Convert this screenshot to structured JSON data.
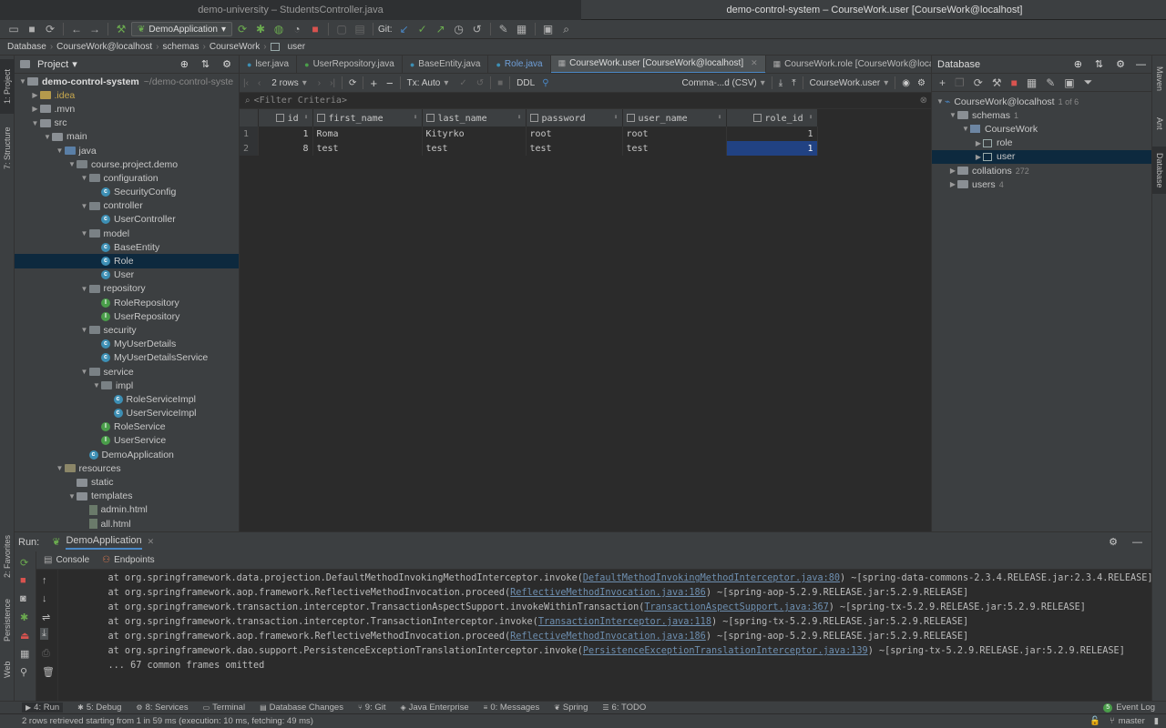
{
  "titlebar": {
    "left": "demo-university – StudentsController.java",
    "right": "demo-control-system – CourseWork.user [CourseWork@localhost]"
  },
  "toolbar": {
    "run_config": "DemoApplication",
    "git_label": "Git:"
  },
  "breadcrumb": [
    "Database",
    "CourseWork@localhost",
    "schemas",
    "CourseWork",
    "user"
  ],
  "left_strip": {
    "project": "1: Project",
    "structure": "7: Structure",
    "favorites": "2: Favorites",
    "persistence": "Persistence",
    "web": "Web"
  },
  "right_strip": {
    "maven": "Maven",
    "ant": "Ant",
    "database": "Database"
  },
  "project": {
    "title": "Project",
    "root_name": "demo-control-system",
    "root_path": "~/demo-control-syste",
    "items": [
      {
        "label": ".idea",
        "indent": 1,
        "type": "idea",
        "arrow": "▶"
      },
      {
        "label": ".mvn",
        "indent": 1,
        "type": "folder",
        "arrow": "▶"
      },
      {
        "label": "src",
        "indent": 1,
        "type": "folder",
        "arrow": "▼"
      },
      {
        "label": "main",
        "indent": 2,
        "type": "folder",
        "arrow": "▼"
      },
      {
        "label": "java",
        "indent": 3,
        "type": "src",
        "arrow": "▼"
      },
      {
        "label": "course.project.demo",
        "indent": 4,
        "type": "pkg",
        "arrow": "▼"
      },
      {
        "label": "configuration",
        "indent": 5,
        "type": "pkg",
        "arrow": "▼"
      },
      {
        "label": "SecurityConfig",
        "indent": 6,
        "type": "class",
        "arrow": ""
      },
      {
        "label": "controller",
        "indent": 5,
        "type": "pkg",
        "arrow": "▼"
      },
      {
        "label": "UserController",
        "indent": 6,
        "type": "class",
        "arrow": ""
      },
      {
        "label": "model",
        "indent": 5,
        "type": "pkg",
        "arrow": "▼"
      },
      {
        "label": "BaseEntity",
        "indent": 6,
        "type": "class",
        "arrow": ""
      },
      {
        "label": "Role",
        "indent": 6,
        "type": "class",
        "arrow": "",
        "selected": true
      },
      {
        "label": "User",
        "indent": 6,
        "type": "class",
        "arrow": ""
      },
      {
        "label": "repository",
        "indent": 5,
        "type": "pkg",
        "arrow": "▼"
      },
      {
        "label": "RoleRepository",
        "indent": 6,
        "type": "interface",
        "arrow": ""
      },
      {
        "label": "UserRepository",
        "indent": 6,
        "type": "interface",
        "arrow": ""
      },
      {
        "label": "security",
        "indent": 5,
        "type": "pkg",
        "arrow": "▼"
      },
      {
        "label": "MyUserDetails",
        "indent": 6,
        "type": "class",
        "arrow": ""
      },
      {
        "label": "MyUserDetailsService",
        "indent": 6,
        "type": "class",
        "arrow": ""
      },
      {
        "label": "service",
        "indent": 5,
        "type": "pkg",
        "arrow": "▼"
      },
      {
        "label": "impl",
        "indent": 6,
        "type": "pkg",
        "arrow": "▼"
      },
      {
        "label": "RoleServiceImpl",
        "indent": 7,
        "type": "class",
        "arrow": ""
      },
      {
        "label": "UserServiceImpl",
        "indent": 7,
        "type": "class",
        "arrow": ""
      },
      {
        "label": "RoleService",
        "indent": 6,
        "type": "interface",
        "arrow": ""
      },
      {
        "label": "UserService",
        "indent": 6,
        "type": "interface",
        "arrow": ""
      },
      {
        "label": "DemoApplication",
        "indent": 5,
        "type": "class",
        "arrow": ""
      },
      {
        "label": "resources",
        "indent": 3,
        "type": "res",
        "arrow": "▼"
      },
      {
        "label": "static",
        "indent": 4,
        "type": "folder",
        "arrow": ""
      },
      {
        "label": "templates",
        "indent": 4,
        "type": "folder",
        "arrow": "▼"
      },
      {
        "label": "admin.html",
        "indent": 5,
        "type": "file",
        "arrow": ""
      },
      {
        "label": "all.html",
        "indent": 5,
        "type": "file",
        "arrow": ""
      }
    ]
  },
  "editor_tabs": [
    {
      "label": "lser.java",
      "active": false
    },
    {
      "label": "UserRepository.java",
      "active": false
    },
    {
      "label": "BaseEntity.java",
      "active": false
    },
    {
      "label": "Role.java",
      "active": false
    },
    {
      "label": "CourseWork.user [CourseWork@localhost]",
      "active": true
    },
    {
      "label": "CourseWork.role [CourseWork@localhost]",
      "active": false
    }
  ],
  "grid_toolbar": {
    "rows": "2 rows",
    "tx": "Tx: Auto",
    "ddl": "DDL",
    "format": "Comma-...d (CSV)",
    "target": "CourseWork.user"
  },
  "filter_placeholder": "<Filter Criteria>",
  "table": {
    "columns": [
      "id",
      "first_name",
      "last_name",
      "password",
      "user_name",
      "role_id"
    ],
    "rows": [
      {
        "n": "1",
        "cells": [
          "1",
          "Roma",
          "Kityrko",
          "root",
          "root",
          "1"
        ]
      },
      {
        "n": "2",
        "cells": [
          "8",
          "test",
          "test",
          "test",
          "test",
          "1"
        ]
      }
    ]
  },
  "database": {
    "title": "Database",
    "connection": "CourseWork@localhost",
    "connection_count": "1 of 6",
    "schemas_label": "schemas",
    "schemas_count": "1",
    "schema": "CourseWork",
    "tables": [
      "role",
      "user"
    ],
    "collations": "collations",
    "collations_count": "272",
    "users": "users",
    "users_count": "4"
  },
  "run": {
    "label": "Run:",
    "config": "DemoApplication",
    "tabs": [
      "Console",
      "Endpoints"
    ],
    "lines": [
      {
        "pre": "    at org.springframework.data.projection.DefaultMethodInvokingMethodInterceptor.invoke(",
        "link": "DefaultMethodInvokingMethodInterceptor.java:80",
        "post": ") ~[spring-data-commons-2.3.4.RELEASE.jar:2.3.4.RELEASE]"
      },
      {
        "pre": "    at org.springframework.aop.framework.ReflectiveMethodInvocation.proceed(",
        "link": "ReflectiveMethodInvocation.java:186",
        "post": ") ~[spring-aop-5.2.9.RELEASE.jar:5.2.9.RELEASE]"
      },
      {
        "pre": "    at org.springframework.transaction.interceptor.TransactionAspectSupport.invokeWithinTransaction(",
        "link": "TransactionAspectSupport.java:367",
        "post": ") ~[spring-tx-5.2.9.RELEASE.jar:5.2.9.RELEASE]"
      },
      {
        "pre": "    at org.springframework.transaction.interceptor.TransactionInterceptor.invoke(",
        "link": "TransactionInterceptor.java:118",
        "post": ") ~[spring-tx-5.2.9.RELEASE.jar:5.2.9.RELEASE]"
      },
      {
        "pre": "    at org.springframework.aop.framework.ReflectiveMethodInvocation.proceed(",
        "link": "ReflectiveMethodInvocation.java:186",
        "post": ") ~[spring-aop-5.2.9.RELEASE.jar:5.2.9.RELEASE]"
      },
      {
        "pre": "    at org.springframework.dao.support.PersistenceExceptionTranslationInterceptor.invoke(",
        "link": "PersistenceExceptionTranslationInterceptor.java:139",
        "post": ") ~[spring-tx-5.2.9.RELEASE.jar:5.2.9.RELEASE]"
      },
      {
        "pre": "    ... 67 common frames omitted",
        "link": "",
        "post": ""
      }
    ]
  },
  "bottom_tabs": [
    "4: Run",
    "5: Debug",
    "8: Services",
    "Terminal",
    "Database Changes",
    "9: Git",
    "Java Enterprise",
    "0: Messages",
    "Spring",
    "6: TODO"
  ],
  "event_log": "Event Log",
  "event_count": "5",
  "status": {
    "message": "2 rows retrieved starting from 1 in 59 ms (execution: 10 ms, fetching: 49 ms)",
    "branch": "master"
  }
}
